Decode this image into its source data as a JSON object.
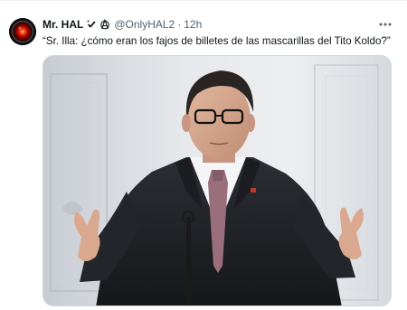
{
  "tweet": {
    "display_name": "Mr. HAL",
    "handle": "@OnlyHAL2",
    "separator": "·",
    "time": "12h",
    "text": "“Sr. Illa: ¿cómo eran los fajos de billetes de las mascarillas del Tito Koldo?”",
    "avatar_icon": "hal-9000-eye-icon",
    "badges": [
      "verified-checkmark-icon",
      "anarchy-symbol-icon"
    ],
    "more_icon": "more-dots-icon",
    "media": {
      "description": "photo",
      "icon": "photo"
    }
  },
  "colors": {
    "text_primary": "#0f1419",
    "text_secondary": "#536471",
    "border": "#cfd9de"
  }
}
